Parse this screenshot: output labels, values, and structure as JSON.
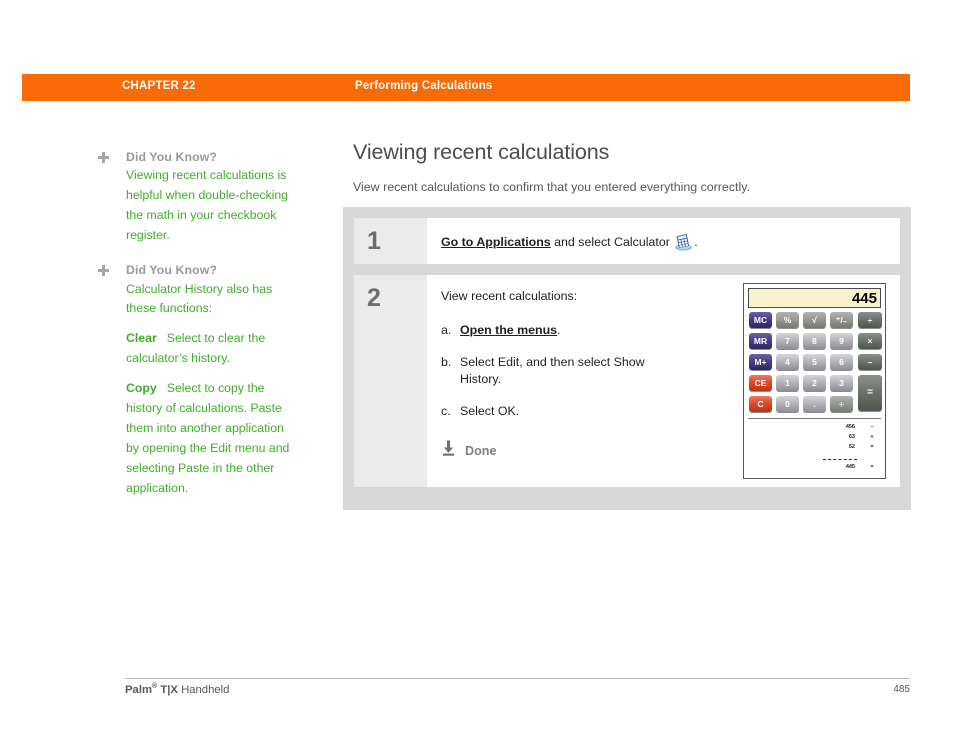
{
  "header": {
    "chapter": "CHAPTER 22",
    "title": "Performing Calculations",
    "band_color": "#f96b07"
  },
  "sidebar": {
    "tips": [
      {
        "heading": "Did You Know?",
        "body": "Viewing recent calculations is helpful when double-checking the math in your checkbook register.",
        "terms": []
      },
      {
        "heading": "Did You Know?",
        "body": "Calculator History also has these functions:",
        "terms": [
          {
            "term": "Clear",
            "text": "Select to clear the calculator’s history."
          },
          {
            "term": "Copy",
            "text": "Select to copy the history of calculations. Paste them into another application by opening the Edit menu and selecting Paste in the other application."
          }
        ]
      }
    ],
    "text_color": "#3fae2a",
    "heading_color": "#9a9a9a"
  },
  "main": {
    "title": "Viewing recent calculations",
    "intro": "View recent calculations to confirm that you entered everything correctly."
  },
  "steps": [
    {
      "number": "1",
      "text_before": "Go to Applications",
      "text_after": " and select Calculator",
      "text_end": "."
    },
    {
      "number": "2",
      "lead": "View recent calculations:",
      "substeps": [
        {
          "letter": "a.",
          "bold": "Open the menus",
          "text": "."
        },
        {
          "letter": "b.",
          "bold": "",
          "text": "Select Edit, and then select Show History."
        },
        {
          "letter": "c.",
          "bold": "",
          "text": "Select OK."
        }
      ],
      "done_label": "Done"
    }
  ],
  "calculator": {
    "display_value": "445",
    "display_color": "#f7f2cd",
    "keys": [
      {
        "label": "MC",
        "type": "mem"
      },
      {
        "label": "%",
        "type": "fn"
      },
      {
        "label": "√",
        "type": "fn"
      },
      {
        "label": "⁺/₋",
        "type": "fn"
      },
      {
        "label": "÷",
        "type": "op"
      },
      {
        "label": "MR",
        "type": "mem"
      },
      {
        "label": "7",
        "type": "num"
      },
      {
        "label": "8",
        "type": "num"
      },
      {
        "label": "9",
        "type": "num"
      },
      {
        "label": "×",
        "type": "op"
      },
      {
        "label": "M+",
        "type": "mem"
      },
      {
        "label": "4",
        "type": "num"
      },
      {
        "label": "5",
        "type": "num"
      },
      {
        "label": "6",
        "type": "num"
      },
      {
        "label": "–",
        "type": "op"
      },
      {
        "label": "CE",
        "type": "red"
      },
      {
        "label": "1",
        "type": "num"
      },
      {
        "label": "2",
        "type": "num"
      },
      {
        "label": "3",
        "type": "num"
      },
      {
        "label": "=",
        "type": "eq"
      },
      {
        "label": "C",
        "type": "red"
      },
      {
        "label": "0",
        "type": "num"
      },
      {
        "label": ".",
        "type": "num"
      },
      {
        "label": "+",
        "type": "fn"
      }
    ],
    "history": [
      {
        "value": "456",
        "op": "–"
      },
      {
        "value": "63",
        "op": "+"
      },
      {
        "value": "52",
        "op": "="
      },
      {
        "value": "445",
        "op": "="
      }
    ]
  },
  "footer": {
    "brand": "Palm",
    "registered": "®",
    "model": " T|X",
    "product": " Handheld",
    "page": "485"
  }
}
